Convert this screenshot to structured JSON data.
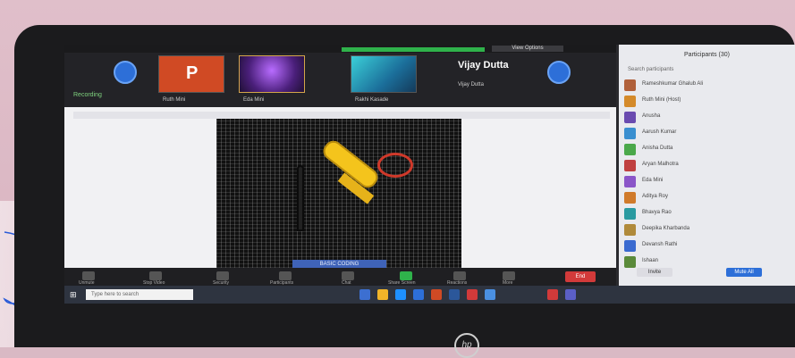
{
  "meeting": {
    "view_options_label": "View Options",
    "speaker_name": "Vijay Dutta",
    "speaker_sub": "Vijay Dutta",
    "top_left_indicator": "Recording",
    "thumbnails": [
      {
        "label": "Ruth Mini",
        "kind": "powerpoint",
        "glyph": "P"
      },
      {
        "label": "Eda Mini",
        "kind": "purple-video"
      },
      {
        "label": "Rakhi Kasade",
        "kind": "teal-video"
      }
    ],
    "shared_button_label": "BASIC CODING",
    "controls": [
      "Unmute",
      "Stop Video",
      "Security",
      "Participants",
      "Chat",
      "Share Screen",
      "Reactions",
      "More"
    ],
    "end_label": "End"
  },
  "taskbar": {
    "search_placeholder": "Type here to search"
  },
  "participants_panel": {
    "title": "Participants (30)",
    "subtitle": "Search participants",
    "people": [
      "Rameshkumar Ghalub Ali",
      "Ruth Mini (Host)",
      "Anusha",
      "Aarush Kumar",
      "Anisha Dutta",
      "Aryan Malhotra",
      "Eda Mini",
      "Aditya Roy",
      "Bhavya Rao",
      "Deepika Kharbanda",
      "Devansh Rathi",
      "Ishaan"
    ],
    "footer_invite": "Invite",
    "footer_mute": "Mute All"
  },
  "colors": {
    "zoom_blue": "#2d6fd8",
    "end_red": "#d23a3a",
    "active_green": "#2fb24b"
  }
}
